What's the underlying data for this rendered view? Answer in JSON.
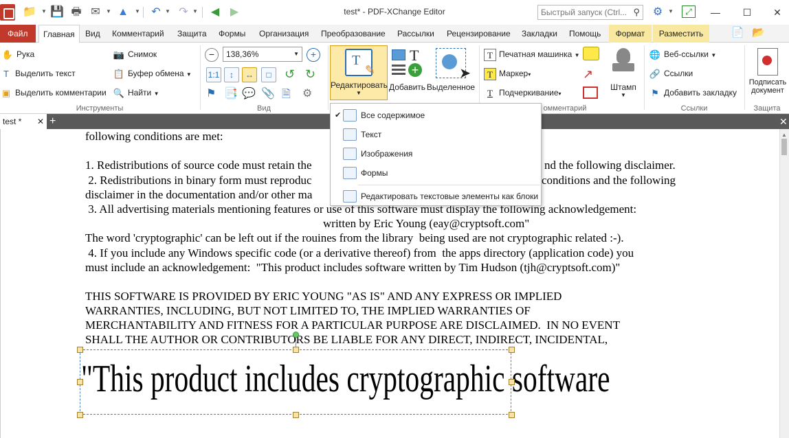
{
  "window": {
    "title": "test* - PDF-XChange Editor",
    "quick_launch_placeholder": "Быстрый запуск (Ctrl..."
  },
  "ribbon_tabs": [
    {
      "label": "Файл"
    },
    {
      "label": "Главная"
    },
    {
      "label": "Вид"
    },
    {
      "label": "Комментарий"
    },
    {
      "label": "Защита"
    },
    {
      "label": "Формы"
    },
    {
      "label": "Организация"
    },
    {
      "label": "Преобразование"
    },
    {
      "label": "Рассылки"
    },
    {
      "label": "Рецензирование"
    },
    {
      "label": "Закладки"
    },
    {
      "label": "Помощь"
    },
    {
      "label": "Формат"
    },
    {
      "label": "Разместить"
    }
  ],
  "ribbon": {
    "tools": {
      "hand": "Рука",
      "select_text": "Выделить текст",
      "select_comments": "Выделить комментарии",
      "snapshot": "Снимок",
      "clipboard": "Буфер обмена",
      "find": "Найти",
      "group_label": "Инструменты"
    },
    "view": {
      "zoom_value": "138,36%",
      "group_label": "Вид"
    },
    "edit": {
      "edit_label": "Редактировать",
      "add_label": "Добавить",
      "selected_label": "Выделенное"
    },
    "comment": {
      "typewriter": "Печатная машинка",
      "marker": "Маркер",
      "underline": "Подчеркивание",
      "stamp": "Штамп",
      "group_label": "омментарий"
    },
    "links": {
      "web_links": "Веб-ссылки",
      "links": "Ссылки",
      "add_bookmark": "Добавить закладку",
      "group_label": "Ссылки"
    },
    "protect": {
      "sign_line1": "Подписать",
      "sign_line2": "документ",
      "group_label": "Защита"
    }
  },
  "doc_tab": {
    "label": "test *"
  },
  "edit_menu": {
    "items": [
      {
        "label": "Все содержимое",
        "checked": true
      },
      {
        "label": "Текст"
      },
      {
        "label": "Изображения"
      },
      {
        "label": "Формы"
      },
      {
        "label": "Редактировать текстовые элементы как блоки"
      }
    ]
  },
  "document": {
    "lines": [
      "following conditions are met:",
      "1. Redistributions of source code must retain the",
      "nd the following disclaimer.",
      " 2. Redistributions in binary form must reproduc",
      "conditions and the following",
      "disclaimer in the documentation and/or other ma",
      " 3. All advertising materials mentioning features or use of this software must display the following acknowledgement:",
      "written by Eric Young (eay@cryptsoft.com\"",
      "The word 'cryptographic' can be left out if the rouines from the library  being used are not cryptographic related :-).",
      " 4. If you include any Windows specific code (or a derivative thereof) from  the apps directory (application code) you",
      "must include an acknowledgement:  \"This product includes software written by Tim Hudson (tjh@cryptsoft.com)\"",
      "THIS SOFTWARE IS PROVIDED BY ERIC YOUNG \"AS IS\" AND ANY EXPRESS OR IMPLIED",
      "WARRANTIES, INCLUDING, BUT NOT LIMITED TO, THE IMPLIED WARRANTIES OF",
      "MERCHANTABILITY AND FITNESS FOR A PARTICULAR PURPOSE ARE DISCLAIMED.  IN NO EVENT",
      "SHALL THE AUTHOR OR CONTRIBUTORS BE LIABLE FOR ANY DIRECT, INDIRECT, INCIDENTAL,"
    ],
    "selected_text": "\"This product includes cryptographic software"
  },
  "colors": {
    "file_tab": "#c0392b",
    "context_tab": "#f8e8a0",
    "doc_tab_bar": "#595959"
  }
}
